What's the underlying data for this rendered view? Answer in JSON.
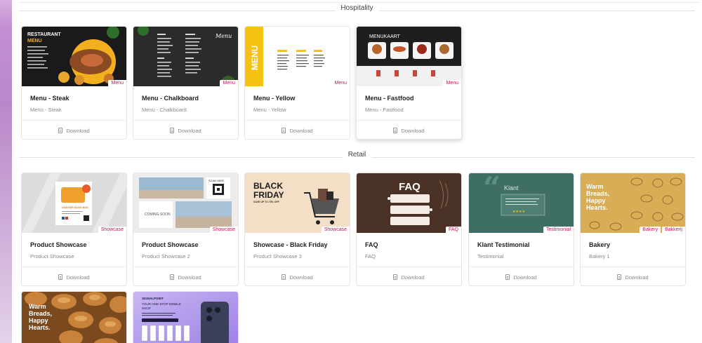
{
  "sections": [
    {
      "label": "Hospitality"
    },
    {
      "label": "Retail"
    }
  ],
  "download_label": "Download",
  "hospitality_cards": [
    {
      "title": "Menu - Steak",
      "subtitle": "Menu - Steak",
      "tags": [
        "Menu"
      ],
      "thumb_text": "RESTAURANT\nMENU"
    },
    {
      "title": "Menu - Chalkboard",
      "subtitle": "Menu - Chalkboard",
      "tags": [
        "Menu"
      ],
      "thumb_text": "Menu"
    },
    {
      "title": "Menu - Yellow",
      "subtitle": "Menu - Yellow",
      "tags": [
        "Menu"
      ],
      "thumb_text": "MENU"
    },
    {
      "title": "Menu - Fastfood",
      "subtitle": "Menu - Fastfood",
      "tags": [
        "Menu"
      ],
      "thumb_text": "MENUKAART"
    }
  ],
  "retail_cards": [
    {
      "title": "Product Showcase",
      "subtitle": "Product Showcase",
      "tags": [
        "Showcase"
      ],
      "thumb_text": "LEATHER SLING BAG"
    },
    {
      "title": "Product Showcase",
      "subtitle": "Product Showcase 2",
      "tags": [
        "Showcase"
      ],
      "thumb_text": "COMING SOON",
      "thumb_text2": "SCAN HIER"
    },
    {
      "title": "Showcase - Black Friday",
      "subtitle": "Product Showcase 3",
      "tags": [
        "Showcase"
      ],
      "thumb_text": "BLACK\nFRIDAY",
      "thumb_text2": "SAVE UP TO 70% OFF"
    },
    {
      "title": "FAQ",
      "subtitle": "FAQ",
      "tags": [
        "FAQ"
      ],
      "thumb_text": "FAQ"
    },
    {
      "title": "Klant Testimonial",
      "subtitle": "Testimonial",
      "tags": [
        "Testimonial"
      ],
      "thumb_text": "Klant"
    },
    {
      "title": "Bakery",
      "subtitle": "Bakery 1",
      "tags": [
        "Bakery",
        "Bakkerij"
      ],
      "thumb_text": "Warm\nBreads,\nHappy\nHearts."
    }
  ],
  "partial_cards": [
    {
      "thumb_text": "Warm\nBreads,\nHappy\nHearts."
    },
    {
      "thumb_text": "SIGNALPOINT",
      "thumb_text2": "YOUR ONE-STOP MOBILE SHOP"
    }
  ],
  "colors": {
    "tag_text": "#c2185b",
    "accent_purple": "#b987ca"
  }
}
